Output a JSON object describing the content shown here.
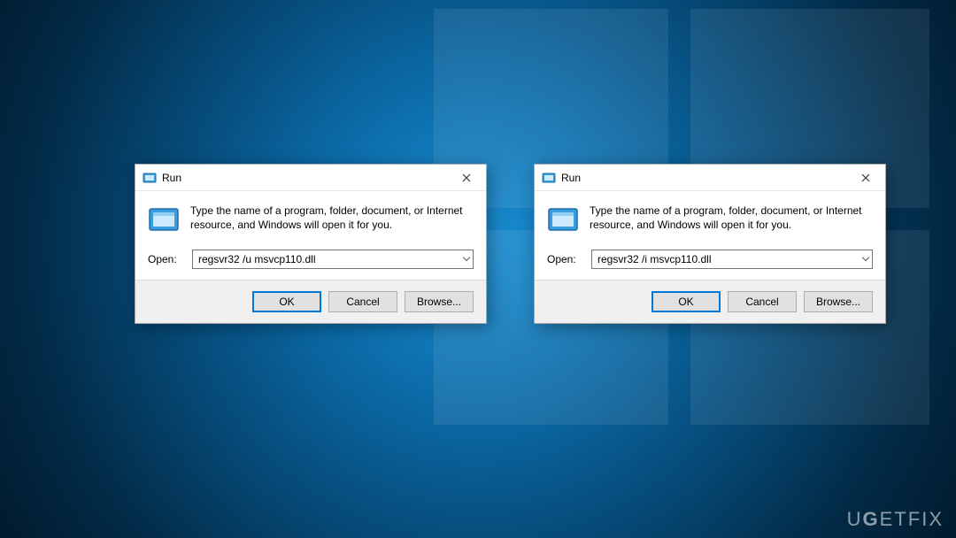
{
  "watermark": "UGETFIX",
  "dialogs": {
    "left": {
      "title": "Run",
      "intro": "Type the name of a program, folder, document, or Internet resource, and Windows will open it for you.",
      "open_label": "Open:",
      "command": "regsvr32 /u msvcp110.dll",
      "buttons": {
        "ok": "OK",
        "cancel": "Cancel",
        "browse": "Browse..."
      }
    },
    "right": {
      "title": "Run",
      "intro": "Type the name of a program, folder, document, or Internet resource, and Windows will open it for you.",
      "open_label": "Open:",
      "command": "regsvr32 /i msvcp110.dll",
      "buttons": {
        "ok": "OK",
        "cancel": "Cancel",
        "browse": "Browse..."
      }
    }
  }
}
